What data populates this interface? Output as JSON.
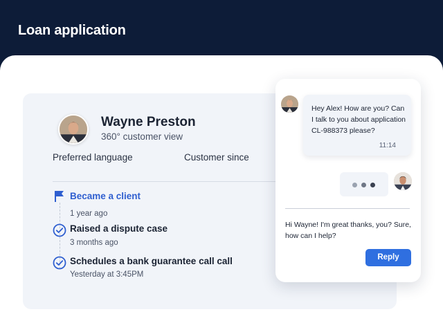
{
  "header": {
    "title": "Loan application"
  },
  "customer": {
    "name": "Wayne Preston",
    "subtitle": "360° customer view",
    "fields": {
      "preferred_language_label": "Preferred language",
      "customer_since_label": "Customer since"
    }
  },
  "timeline": [
    {
      "title": "Became a client",
      "date": "1 year ago",
      "icon": "flag-icon"
    },
    {
      "title": "Raised a dispute case",
      "date": "3 months ago",
      "icon": "check-circle-icon"
    },
    {
      "title": "Schedules a bank guarantee call call",
      "date": "Yesterday at 3:45PM",
      "icon": "check-circle-icon"
    }
  ],
  "chat": {
    "incoming_message": {
      "text": "Hey Alex! How are you? Can I talk to you about application CL-988373 please?",
      "time": "11:14"
    },
    "typing_indicator": "typing-dots",
    "reply_draft": "Hi Wayne! I'm great thanks, you? Sure, how can I help?",
    "reply_button_label": "Reply"
  },
  "colors": {
    "header_bg": "#0d1c38",
    "accent_blue": "#2f6fe0",
    "timeline_blue": "#2f5fd0",
    "card_bg": "#f1f4f9"
  }
}
